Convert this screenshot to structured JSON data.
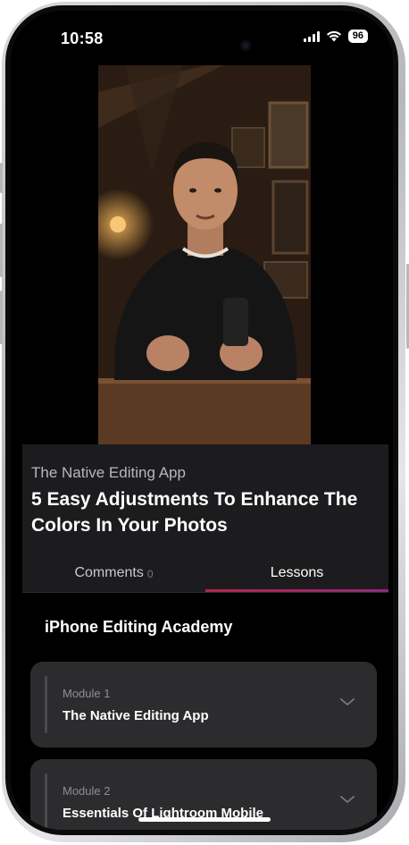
{
  "status_bar": {
    "time": "10:58",
    "battery": "96"
  },
  "video": {
    "icon": "video-thumbnail-presenter"
  },
  "lesson": {
    "course_name": "The Native Editing App",
    "title": "5 Easy Adjustments To Enhance The Colors In Your Photos"
  },
  "tabs": {
    "comments_label": "Comments",
    "comments_count": "0",
    "lessons_label": "Lessons",
    "active": "Lessons"
  },
  "academy": {
    "title": "iPhone Editing Academy"
  },
  "modules": [
    {
      "label": "Module 1",
      "name": "The Native Editing App",
      "icon": "chevron-down-icon"
    },
    {
      "label": "Module 2",
      "name": "Essentials Of Lightroom Mobile",
      "icon": "chevron-down-icon"
    }
  ],
  "colors": {
    "accent_start": "#b2274a",
    "accent_end": "#8e2a7a",
    "background": "#000000",
    "panel": "#1c1c1e",
    "card": "#2c2c2e"
  }
}
